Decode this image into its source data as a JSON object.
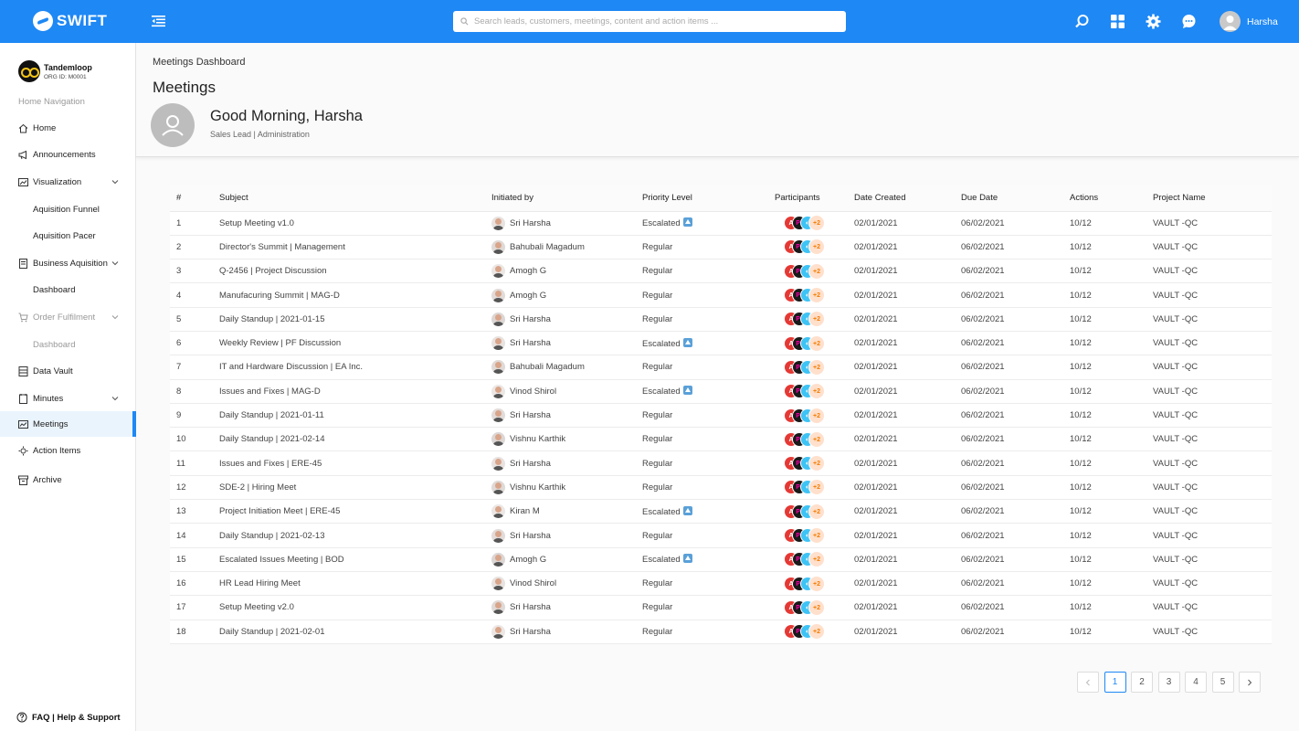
{
  "app": {
    "brand": "SWIFT"
  },
  "search": {
    "placeholder": "Search leads, customers, meetings, content and action items ..."
  },
  "topbar": {
    "user_name": "Harsha"
  },
  "org": {
    "name": "Tandemloop",
    "id": "ORG ID: M0001"
  },
  "sidebar": {
    "heading": "Home Navigation",
    "items": [
      {
        "label": "Home",
        "icon": "home-icon"
      },
      {
        "label": "Announcements",
        "icon": "megaphone-icon"
      },
      {
        "label": "Visualization",
        "icon": "chart-icon",
        "expandable": true
      },
      {
        "label": "Aquisition Funnel",
        "sub": true
      },
      {
        "label": "Aquisition Pacer",
        "sub": true
      },
      {
        "label": "Business Aquisition",
        "icon": "document-icon",
        "expandable": true
      },
      {
        "label": "Dashboard",
        "sub": true
      },
      {
        "label": "Order Fulfilment",
        "icon": "cart-icon",
        "expandable": true,
        "disabled": true
      },
      {
        "label": "Dashboard",
        "sub": true,
        "disabled": true
      },
      {
        "label": "Data Vault",
        "icon": "vault-icon"
      },
      {
        "label": "Minutes",
        "icon": "notes-icon",
        "expandable": true
      },
      {
        "label": "Meetings",
        "icon": "meetings-icon",
        "active": true
      },
      {
        "label": "Action Items",
        "icon": "action-icon"
      },
      {
        "label": "Archive",
        "icon": "archive-icon"
      }
    ],
    "faq": "FAQ | Help & Support"
  },
  "header": {
    "breadcrumb": "Meetings Dashboard",
    "title": "Meetings",
    "greeting": "Good Morning, Harsha",
    "role": "Sales Lead | Administration"
  },
  "table": {
    "columns": [
      "#",
      "Subject",
      "Initiated by",
      "Priority Level",
      "Participants",
      "Date Created",
      "Due Date",
      "Actions",
      "Project Name"
    ],
    "participants_extra": "+2",
    "rows": [
      {
        "num": "1",
        "subject": "Setup Meeting v1.0",
        "initiator": "Sri Harsha",
        "priority": "Escalated",
        "created": "02/01/2021",
        "due": "06/02/2021",
        "actions": "10/12",
        "project": "VAULT -QC"
      },
      {
        "num": "2",
        "subject": "Director's Summit | Management",
        "initiator": "Bahubali Magadum",
        "priority": "Regular",
        "created": "02/01/2021",
        "due": "06/02/2021",
        "actions": "10/12",
        "project": "VAULT -QC"
      },
      {
        "num": "3",
        "subject": "Q-2456 | Project Discussion",
        "initiator": "Amogh G",
        "priority": "Regular",
        "created": "02/01/2021",
        "due": "06/02/2021",
        "actions": "10/12",
        "project": "VAULT -QC"
      },
      {
        "num": "4",
        "subject": "Manufacuring Summit | MAG-D",
        "initiator": "Amogh G",
        "priority": "Regular",
        "created": "02/01/2021",
        "due": "06/02/2021",
        "actions": "10/12",
        "project": "VAULT -QC"
      },
      {
        "num": "5",
        "subject": "Daily Standup | 2021-01-15",
        "initiator": "Sri Harsha",
        "priority": "Regular",
        "created": "02/01/2021",
        "due": "06/02/2021",
        "actions": "10/12",
        "project": "VAULT -QC"
      },
      {
        "num": "6",
        "subject": "Weekly Review | PF Discussion",
        "initiator": "Sri Harsha",
        "priority": "Escalated",
        "created": "02/01/2021",
        "due": "06/02/2021",
        "actions": "10/12",
        "project": "VAULT -QC"
      },
      {
        "num": "7",
        "subject": "IT and Hardware Discussion | EA Inc.",
        "initiator": "Bahubali Magadum",
        "priority": "Regular",
        "created": "02/01/2021",
        "due": "06/02/2021",
        "actions": "10/12",
        "project": "VAULT -QC"
      },
      {
        "num": "8",
        "subject": "Issues and Fixes | MAG-D",
        "initiator": "Vinod Shirol",
        "priority": "Escalated",
        "created": "02/01/2021",
        "due": "06/02/2021",
        "actions": "10/12",
        "project": "VAULT -QC"
      },
      {
        "num": "9",
        "subject": "Daily Standup | 2021-01-11",
        "initiator": "Sri Harsha",
        "priority": "Regular",
        "created": "02/01/2021",
        "due": "06/02/2021",
        "actions": "10/12",
        "project": "VAULT -QC"
      },
      {
        "num": "10",
        "subject": "Daily Standup | 2021-02-14",
        "initiator": "Vishnu Karthik",
        "priority": "Regular",
        "created": "02/01/2021",
        "due": "06/02/2021",
        "actions": "10/12",
        "project": "VAULT -QC"
      },
      {
        "num": "11",
        "subject": "Issues and Fixes | ERE-45",
        "initiator": "Sri Harsha",
        "priority": "Regular",
        "created": "02/01/2021",
        "due": "06/02/2021",
        "actions": "10/12",
        "project": "VAULT -QC"
      },
      {
        "num": "12",
        "subject": "SDE-2 | Hiring Meet",
        "initiator": "Vishnu Karthik",
        "priority": "Regular",
        "created": "02/01/2021",
        "due": "06/02/2021",
        "actions": "10/12",
        "project": "VAULT -QC"
      },
      {
        "num": "13",
        "subject": "Project Initiation Meet | ERE-45",
        "initiator": "Kiran M",
        "priority": "Escalated",
        "created": "02/01/2021",
        "due": "06/02/2021",
        "actions": "10/12",
        "project": "VAULT -QC"
      },
      {
        "num": "14",
        "subject": "Daily Standup | 2021-02-13",
        "initiator": "Sri Harsha",
        "priority": "Regular",
        "created": "02/01/2021",
        "due": "06/02/2021",
        "actions": "10/12",
        "project": "VAULT -QC"
      },
      {
        "num": "15",
        "subject": "Escalated Issues Meeting | BOD",
        "initiator": "Amogh G",
        "priority": "Escalated",
        "created": "02/01/2021",
        "due": "06/02/2021",
        "actions": "10/12",
        "project": "VAULT -QC"
      },
      {
        "num": "16",
        "subject": "HR Lead Hiring Meet",
        "initiator": "Vinod Shirol",
        "priority": "Regular",
        "created": "02/01/2021",
        "due": "06/02/2021",
        "actions": "10/12",
        "project": "VAULT -QC"
      },
      {
        "num": "17",
        "subject": "Setup Meeting v2.0",
        "initiator": "Sri Harsha",
        "priority": "Regular",
        "created": "02/01/2021",
        "due": "06/02/2021",
        "actions": "10/12",
        "project": "VAULT -QC"
      },
      {
        "num": "18",
        "subject": "Daily Standup | 2021-02-01",
        "initiator": "Sri Harsha",
        "priority": "Regular",
        "created": "02/01/2021",
        "due": "06/02/2021",
        "actions": "10/12",
        "project": "VAULT -QC"
      }
    ]
  },
  "pagination": {
    "pages": [
      "1",
      "2",
      "3",
      "4",
      "5"
    ],
    "current": "1"
  },
  "colors": {
    "primary": "#1e88f5",
    "active_bg": "#eaf4fd"
  }
}
